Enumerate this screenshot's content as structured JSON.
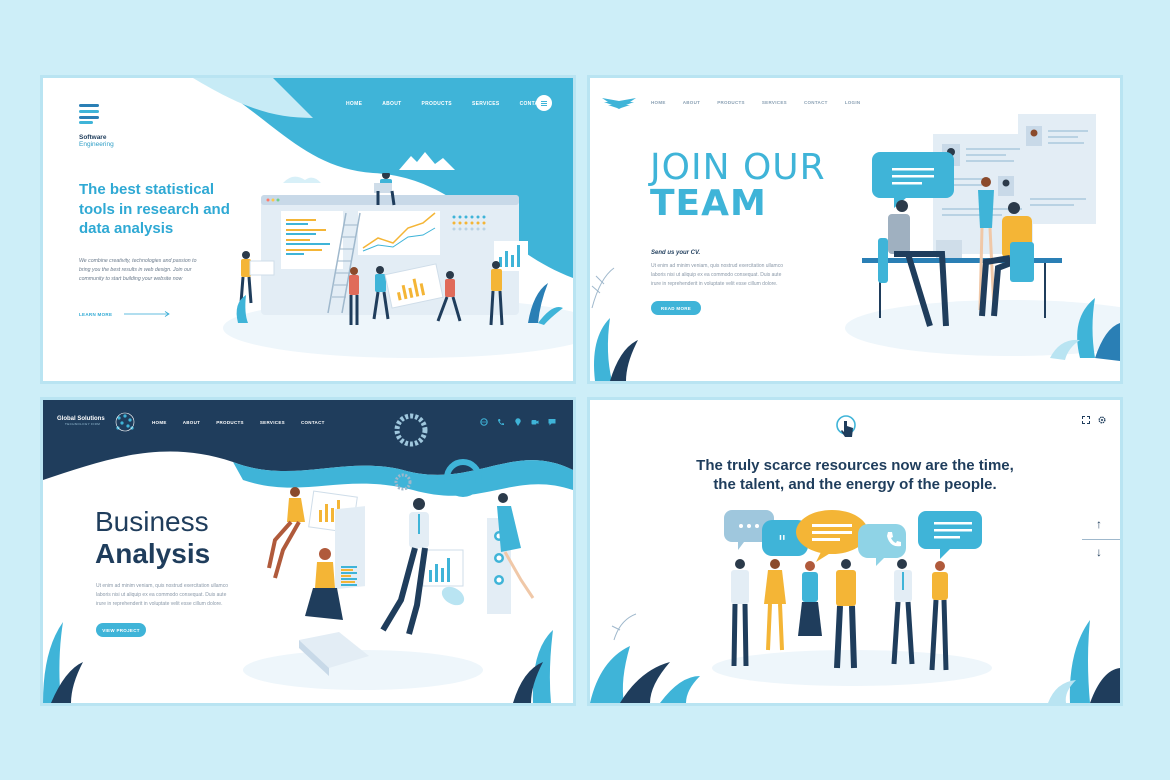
{
  "colors": {
    "page_bg": "#cdeef8",
    "accent": "#3fb4d8",
    "navy": "#1f3d5c",
    "title_blue": "#2f9ec6"
  },
  "card1": {
    "logo_line1": "Software",
    "logo_line2": "Engineering",
    "nav": [
      "HOME",
      "ABOUT",
      "PRODUCTS",
      "SERVICES",
      "CONTACT"
    ],
    "menu_icon": "menu-icon",
    "headline": [
      "The best statistical",
      "tools in research and",
      "data analysis"
    ],
    "body": [
      "We combine creativity, technologies and passion to",
      "bring you the best results in web design. Join our",
      "community to start building your website now"
    ],
    "link": "LEARN MORE"
  },
  "card2": {
    "logo_icon": "wings-logo-icon",
    "nav": [
      "HOME",
      "ABOUT",
      "PRODUCTS",
      "SERVICES",
      "CONTACT",
      "LOGIN"
    ],
    "title_line1": "JOIN OUR",
    "title_line2": "TEAM",
    "subtitle": "Send us your CV.",
    "body": [
      "Ut enim ad minim veniam, quis nostrud exercitation ullamco",
      "laboris nisi ut aliquip ex ea commodo consequat. Duis aute",
      "irure in reprehenderit in voluptate velit esse cillum dolore."
    ],
    "button": "READ MORE"
  },
  "card3": {
    "logo_line1": "Global Solutions",
    "logo_line2": "TECHNOLOGY FIRM",
    "nav": [
      "HOME",
      "ABOUT",
      "PRODUCTS",
      "SERVICES",
      "CONTACT"
    ],
    "icons": [
      "globe-icon",
      "phone-icon",
      "location-icon",
      "video-icon",
      "chat-icon"
    ],
    "title_line1": "Business",
    "title_line2": "Analysis",
    "body": [
      "Ut enim ad minim veniam, quis nostrud exercitation ullamco",
      "laboris nisi ut aliquip ex ea commodo consequat. Duis aute",
      "irure in reprehenderit in voluptate velit esse cillum dolore."
    ],
    "button": "VIEW PROJECT"
  },
  "card4": {
    "logo_icon": "touch-icon",
    "top_icons": [
      "expand-icon",
      "settings-icon"
    ],
    "quote_line1": "The truly scarce resources now are the time,",
    "quote_line2": "the talent, and the energy of the people.",
    "scroll_up": "↑",
    "scroll_down": "↓"
  }
}
